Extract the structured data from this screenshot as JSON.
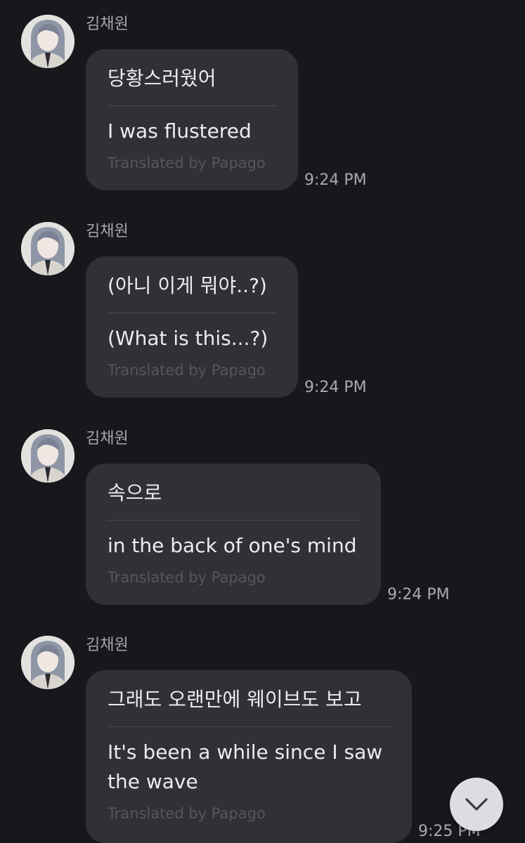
{
  "messages": [
    {
      "sender": "김채원",
      "original": "당황스러웠어",
      "translated": "I was flustered",
      "credit": "Translated by Papago",
      "time": "9:24 PM"
    },
    {
      "sender": "김채원",
      "original": "(아니 이게 뭐야..?)",
      "translated": "(What is this...?)",
      "credit": "Translated by Papago",
      "time": "9:24 PM"
    },
    {
      "sender": "김채원",
      "original": "속으로",
      "translated": "in the back of one's mind",
      "credit": "Translated by Papago",
      "time": "9:24 PM"
    },
    {
      "sender": "김채원",
      "original": "그래도 오랜만에 웨이브도 보고",
      "translated": "It's been a while since I saw the wave",
      "credit": "Translated by Papago",
      "time": "9:25 PM"
    }
  ],
  "scroll_button": {
    "icon": "chevron-down-icon"
  },
  "colors": {
    "background": "#17181c",
    "bubble": "#303136",
    "text": "#ececef",
    "muted": "#a6a7ad",
    "credit": "#54565c"
  }
}
